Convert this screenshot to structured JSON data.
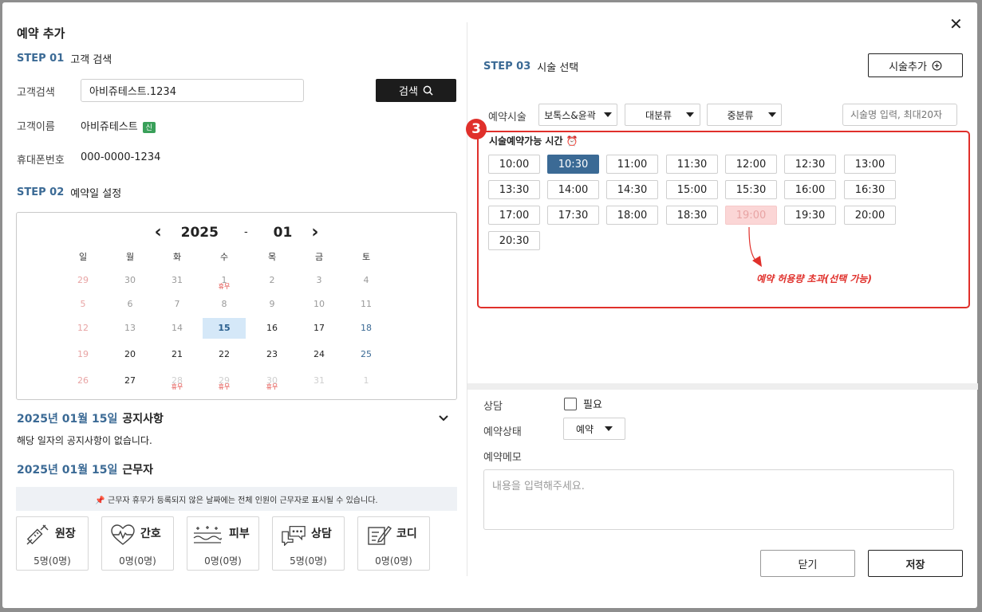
{
  "modal": {
    "title": "예약 추가",
    "close_label": "✕"
  },
  "step1": {
    "num": "STEP 01",
    "label": "고객 검색",
    "search_label": "고객검색",
    "search_value": "아비쥬테스트.1234",
    "search_button": "검색",
    "name_label": "고객이름",
    "name_value": "아비쥬테스트",
    "name_badge": "신",
    "phone_label": "휴대폰번호",
    "phone_value": "000-0000-1234"
  },
  "step2": {
    "num": "STEP 02",
    "label": "예약일 설정",
    "year": "2025",
    "sep": "-",
    "month": "01",
    "prev": "‹",
    "next": "›",
    "weekdays": [
      "일",
      "월",
      "화",
      "수",
      "목",
      "금",
      "토"
    ],
    "holiday_label": "휴무",
    "selected_day": "15"
  },
  "notice": {
    "date": "2025년 01월 15일",
    "title": "공지사항",
    "empty": "해당 일자의 공지사항이 없습니다."
  },
  "staff": {
    "date": "2025년 01월 15일",
    "title": "근무자",
    "info": "📌 근무자 휴무가 등록되지 않은 날짜에는 전체 인원이 근무자로 표시될 수 있습니다.",
    "items": [
      {
        "name": "원장",
        "count": "5명(0명)",
        "icon": "syringe-icon"
      },
      {
        "name": "간호",
        "count": "0명(0명)",
        "icon": "heartbeat-icon"
      },
      {
        "name": "피부",
        "count": "0명(0명)",
        "icon": "skin-icon"
      },
      {
        "name": "상담",
        "count": "5명(0명)",
        "icon": "chat-icon"
      },
      {
        "name": "코디",
        "count": "0명(0명)",
        "icon": "edit-icon"
      }
    ]
  },
  "step3": {
    "num": "STEP 03",
    "label": "시술 선택",
    "add_button": "시술추가",
    "treatment_label": "예약시술",
    "select1": "보톡스&윤곽",
    "select2": "대분류",
    "select3": "중분류",
    "search_placeholder": "시술명 입력, 최대20자",
    "marker": "3",
    "times_title": "시술예약가능 시간 ⏰",
    "times": [
      "10:00",
      "10:30",
      "11:00",
      "11:30",
      "12:00",
      "12:30",
      "13:00",
      "13:30",
      "14:00",
      "14:30",
      "15:00",
      "15:30",
      "16:00",
      "16:30",
      "17:00",
      "17:30",
      "18:00",
      "18:30",
      "19:00",
      "19:30",
      "20:00",
      "20:30"
    ],
    "active_time": "10:30",
    "over_time": "19:00",
    "over_note": "예약 허용량 초과(선택 가능)"
  },
  "bottom": {
    "consult_label": "상담",
    "consult_check": "필요",
    "status_label": "예약상태",
    "status_value": "예약",
    "memo_label": "예약메모",
    "memo_placeholder": "내용을 입력해주세요.",
    "close_button": "닫기",
    "save_button": "저장"
  },
  "colors": {
    "accent": "#3b6a95",
    "danger": "#e0302b",
    "selected_bg": "#d5e8f8"
  }
}
